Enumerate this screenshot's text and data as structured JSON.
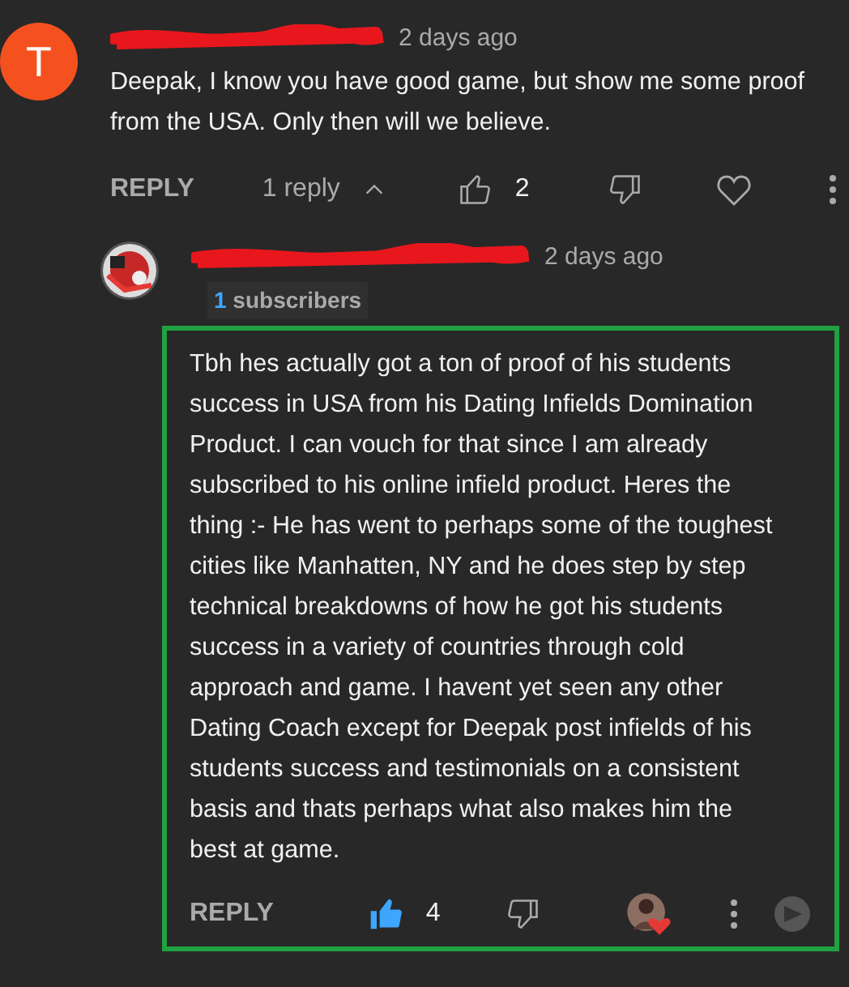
{
  "comments": [
    {
      "avatar": {
        "kind": "letter",
        "letter": "T"
      },
      "time": "2 days ago",
      "text": "Deepak, I know you have good game, but show me some proof from the USA. Only then will we believe.",
      "reply_label": "REPLY",
      "replies_toggle": "1 reply",
      "expanded": true,
      "likes": "2",
      "liked": false,
      "hearted": false,
      "highlighted": false
    },
    {
      "time": "2 days ago",
      "badge": {
        "count": "1",
        "label": "subscribers"
      },
      "text": "Tbh hes actually got a ton of proof of his students success in USA from his Dating Infields Domination Product. I can vouch for that since I am already subscribed to his online infield product. Heres the thing :- He has went to perhaps some of the toughest cities like Manhatten, NY and he does step by step technical breakdowns of how he got his students success in a variety of countries through cold approach and game. I havent yet seen any other Dating Coach except for Deepak post infields of his students success and testimonials on a consistent basis and thats perhaps what also makes him the best at game.",
      "reply_label": "REPLY",
      "likes": "4",
      "liked": true,
      "hearted": true,
      "highlighted": true
    }
  ]
}
